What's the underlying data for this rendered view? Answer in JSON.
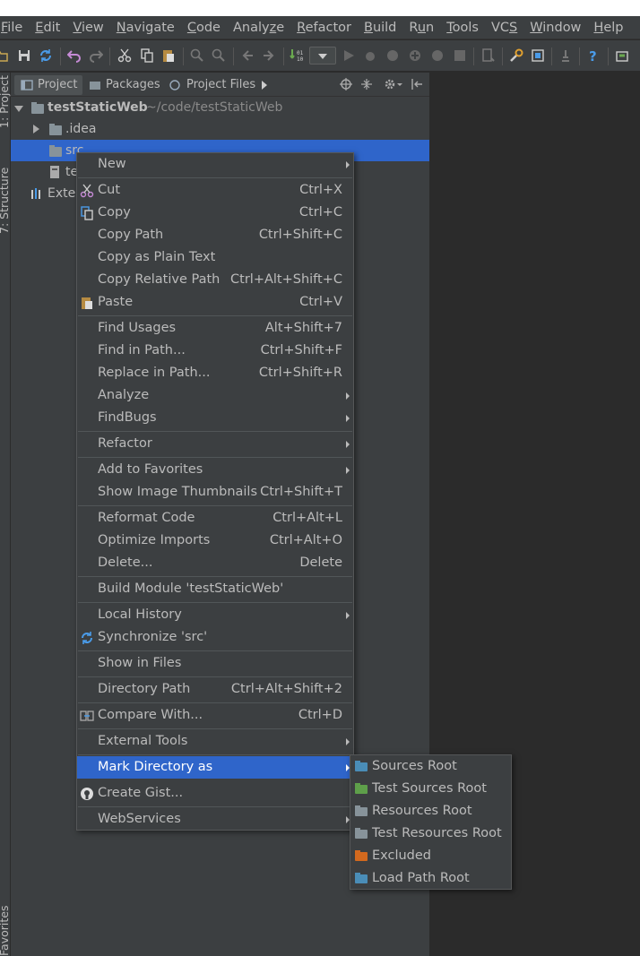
{
  "menubar": {
    "items": [
      {
        "label": "File",
        "pre": "",
        "mn": "F",
        "post": "ile"
      },
      {
        "label": "Edit",
        "pre": "",
        "mn": "E",
        "post": "dit"
      },
      {
        "label": "View",
        "pre": "",
        "mn": "V",
        "post": "iew"
      },
      {
        "label": "Navigate",
        "pre": "",
        "mn": "N",
        "post": "avigate"
      },
      {
        "label": "Code",
        "pre": "",
        "mn": "C",
        "post": "ode"
      },
      {
        "label": "Analyze",
        "pre": "Analy",
        "mn": "z",
        "post": "e"
      },
      {
        "label": "Refactor",
        "pre": "",
        "mn": "R",
        "post": "efactor"
      },
      {
        "label": "Build",
        "pre": "",
        "mn": "B",
        "post": "uild"
      },
      {
        "label": "Run",
        "pre": "R",
        "mn": "u",
        "post": "n"
      },
      {
        "label": "Tools",
        "pre": "",
        "mn": "T",
        "post": "ools"
      },
      {
        "label": "VCS",
        "pre": "VC",
        "mn": "S",
        "post": ""
      },
      {
        "label": "Window",
        "pre": "",
        "mn": "W",
        "post": "indow"
      },
      {
        "label": "Help",
        "pre": "",
        "mn": "H",
        "post": "elp"
      }
    ]
  },
  "left_stripe": {
    "project_tab": "1: Project",
    "structure_tab": "7: Structure",
    "favorites_tab": "Favorites"
  },
  "panel": {
    "tabs": [
      {
        "label": "Project"
      },
      {
        "label": "Packages"
      },
      {
        "label": "Project Files"
      }
    ]
  },
  "tree": {
    "root_name": "testStaticWeb",
    "root_path": "~/code/testStaticWeb",
    "idea": ".idea",
    "src": "src",
    "file_partial": "te",
    "external_partial": "Exter"
  },
  "context_menu": {
    "new": "New",
    "cut": "Cut",
    "cut_sc": "Ctrl+X",
    "copy": "Copy",
    "copy_sc": "Ctrl+C",
    "copy_path": "Copy Path",
    "copy_path_sc": "Ctrl+Shift+C",
    "copy_plain": "Copy as Plain Text",
    "copy_relative": "Copy Relative Path",
    "copy_relative_sc": "Ctrl+Alt+Shift+C",
    "paste": "Paste",
    "paste_sc": "Ctrl+V",
    "find_usages": "Find Usages",
    "find_usages_sc": "Alt+Shift+7",
    "find_in_path": "Find in Path...",
    "find_in_path_sc": "Ctrl+Shift+F",
    "replace_in_path": "Replace in Path...",
    "replace_in_path_sc": "Ctrl+Shift+R",
    "analyze": "Analyze",
    "findbugs": "FindBugs",
    "refactor": "Refactor",
    "add_favorites": "Add to Favorites",
    "show_thumbnails": "Show Image Thumbnails",
    "show_thumbnails_sc": "Ctrl+Shift+T",
    "reformat": "Reformat Code",
    "reformat_sc": "Ctrl+Alt+L",
    "optimize": "Optimize Imports",
    "optimize_sc": "Ctrl+Alt+O",
    "delete": "Delete...",
    "delete_sc": "Delete",
    "build_module": "Build Module 'testStaticWeb'",
    "local_history": "Local History",
    "synchronize": "Synchronize 'src'",
    "show_files": "Show in Files",
    "directory_path": "Directory Path",
    "directory_path_sc": "Ctrl+Alt+Shift+2",
    "compare": "Compare With...",
    "compare_sc": "Ctrl+D",
    "external_tools": "External Tools",
    "mark_directory": "Mark Directory as",
    "create_gist": "Create Gist...",
    "webservices": "WebServices"
  },
  "submenu": {
    "items": [
      {
        "label": "Sources Root",
        "color": "#4a8db7"
      },
      {
        "label": "Test Sources Root",
        "color": "#5e9f4a"
      },
      {
        "label": "Resources Root",
        "color": "#87939a"
      },
      {
        "label": "Test Resources Root",
        "color": "#87939a"
      },
      {
        "label": "Excluded",
        "color": "#d2691e"
      },
      {
        "label": "Load Path Root",
        "color": "#4a8db7"
      }
    ]
  },
  "colors": {
    "selection": "#2f65ca",
    "panel_bg": "#3c3f41",
    "editor_bg": "#2b2b2b",
    "text": "#bbbbbb"
  }
}
